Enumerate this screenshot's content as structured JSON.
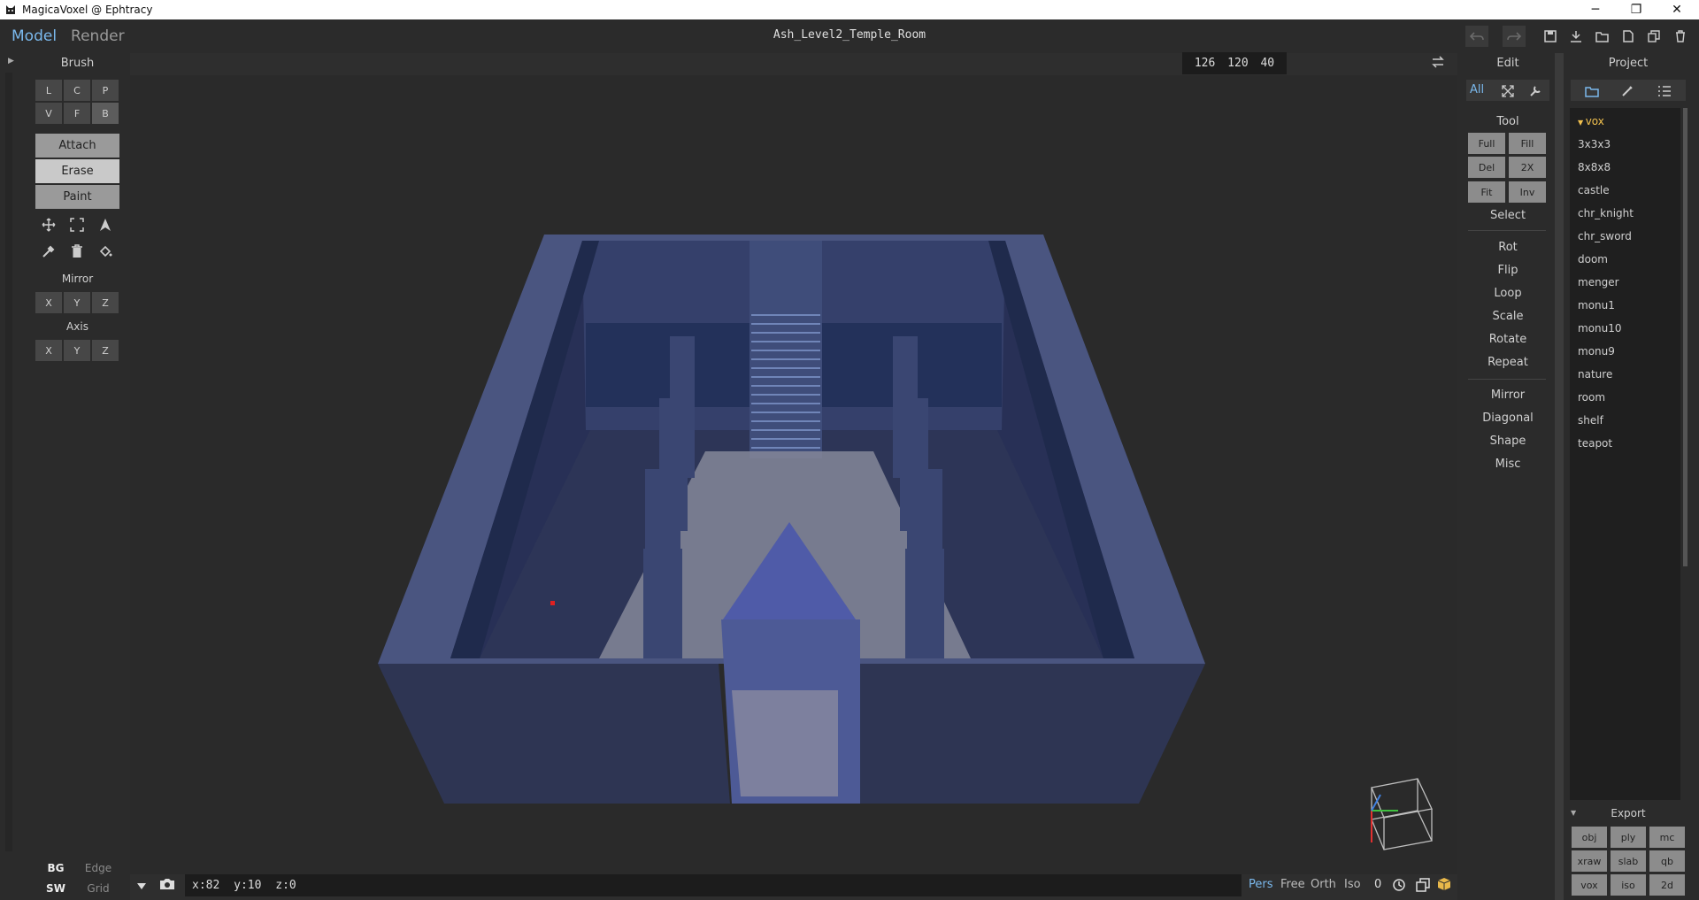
{
  "window": {
    "title": "MagicaVoxel @ Ephtracy",
    "minimize_glyph": "─",
    "restore_glyph": "❐",
    "close_glyph": "✕"
  },
  "menubar": {
    "tabs": [
      {
        "label": "Model"
      },
      {
        "label": "Render"
      }
    ],
    "document_title": "Ash_Level2_Temple_Room"
  },
  "toolbar": {
    "icons": [
      "undo-icon",
      "redo-icon",
      "save-icon",
      "download-icon",
      "open-folder-icon",
      "new-file-icon",
      "copy-icon",
      "delete-icon"
    ]
  },
  "brush": {
    "header": "Brush",
    "types_row1": [
      "L",
      "C",
      "P"
    ],
    "types_row2": [
      "V",
      "F",
      "B"
    ],
    "modes": [
      "Attach",
      "Erase",
      "Paint"
    ],
    "selected_mode": "Erase",
    "tool_icons": [
      "move-icon",
      "marquee-icon",
      "cursor-icon",
      "eyedropper-icon",
      "trash-icon",
      "fill-bucket-icon"
    ],
    "mirror_label": "Mirror",
    "mirror_axes": [
      "X",
      "Y",
      "Z"
    ],
    "axis_label": "Axis",
    "axis_axes": [
      "X",
      "Y",
      "Z"
    ],
    "bg_label": "BG",
    "edge_label": "Edge",
    "sw_label": "SW",
    "grid_label": "Grid"
  },
  "viewport": {
    "dimensions": "126 120 40",
    "cursor": "x:82  y:10  z:0",
    "view_modes": [
      "Pers",
      "Free",
      "Orth",
      "Iso"
    ],
    "active_view": "Pers",
    "counter": "0",
    "colors": {
      "wall_top": "#4a5580",
      "wall_front": "#2e3553",
      "wall_side": "#394369",
      "floor": "#2a3050",
      "light": "#8a8ba0"
    }
  },
  "edit": {
    "header": "Edit",
    "filter_all": "All",
    "tool_label": "Tool",
    "tool_buttons": [
      "Full",
      "Fill",
      "Del",
      "2X",
      "Fit",
      "Inv"
    ],
    "select_label": "Select",
    "transforms": [
      "Rot",
      "Flip",
      "Loop",
      "Scale",
      "Rotate",
      "Repeat"
    ],
    "extras": [
      "Mirror",
      "Diagonal",
      "Shape",
      "Misc"
    ]
  },
  "project": {
    "header": "Project",
    "folder": "vox",
    "files": [
      "3x3x3",
      "8x8x8",
      "castle",
      "chr_knight",
      "chr_sword",
      "doom",
      "menger",
      "monu1",
      "monu10",
      "monu9",
      "nature",
      "room",
      "shelf",
      "teapot"
    ],
    "export_label": "Export",
    "export_formats": [
      "obj",
      "ply",
      "mc",
      "xraw",
      "slab",
      "qb",
      "vox",
      "iso",
      "2d"
    ]
  },
  "colors": {
    "accent": "#7ab8ec",
    "folder": "#f2c14e",
    "panel": "#2b2b2b",
    "viewport": "#2a2a2a"
  }
}
